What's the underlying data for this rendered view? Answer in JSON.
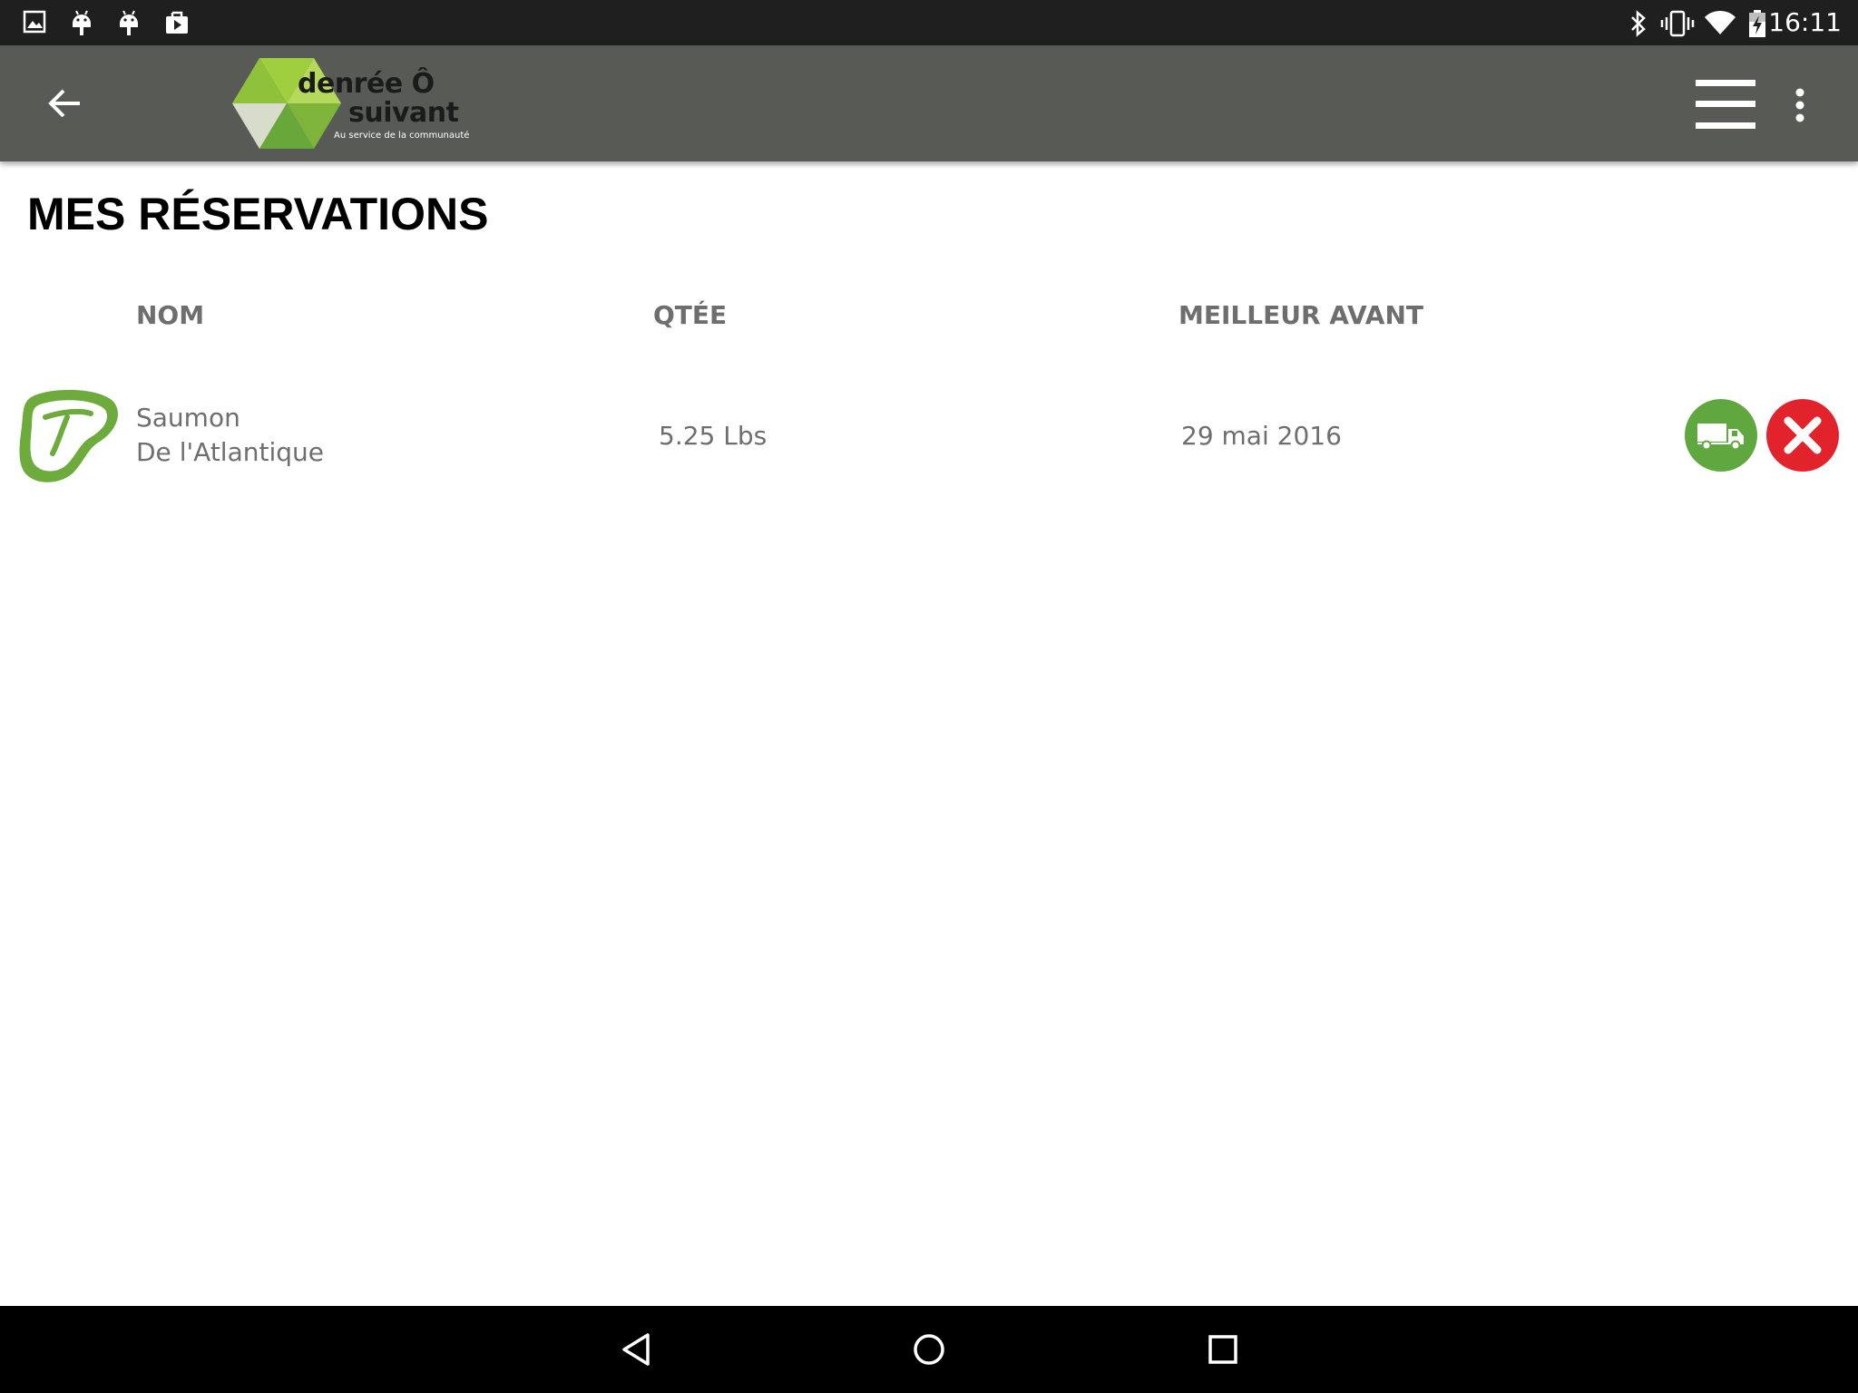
{
  "status_bar": {
    "time": "16:11",
    "left_icons": [
      "gallery-icon",
      "android-icon",
      "android-icon",
      "play-store-icon"
    ],
    "right_icons": [
      "bluetooth-icon",
      "vibrate-icon",
      "wifi-icon",
      "battery-charging-icon"
    ]
  },
  "app_bar": {
    "back_icon": "arrow-left-icon",
    "logo": {
      "line1": "denrée Ô",
      "line2": "suivant",
      "tagline": "Au service de la communauté"
    },
    "menu_icon": "hamburger-icon",
    "overflow_icon": "more-vert-icon"
  },
  "page": {
    "title": "MES RÉSERVATIONS"
  },
  "table": {
    "headers": {
      "name": "NOM",
      "quantity": "QTÉE",
      "best_before": "MEILLEUR AVANT"
    },
    "rows": [
      {
        "icon": "meat-steak-icon",
        "name_line1": "Saumon",
        "name_line2": "De l'Atlantique",
        "quantity": "5.25 Lbs",
        "best_before": "29 mai 2016",
        "actions": [
          "truck-icon",
          "close-icon"
        ]
      }
    ]
  },
  "nav_bar": {
    "buttons": [
      "back-triangle-icon",
      "home-circle-icon",
      "recents-square-icon"
    ]
  },
  "colors": {
    "status_bar": "#1f1f1f",
    "app_bar": "#585a56",
    "accent_green": "#5fa73f",
    "danger_red": "#e3232c",
    "text_gray": "#6e6e6e"
  }
}
